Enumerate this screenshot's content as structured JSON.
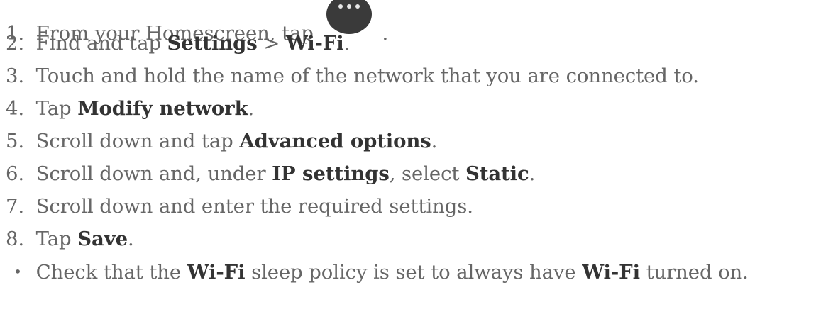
{
  "steps": [
    {
      "num": "1.",
      "parts": [
        "From your Homescreen, tap",
        "."
      ]
    },
    {
      "num": "2.",
      "parts": [
        "Find and tap ",
        "Settings",
        " > ",
        "Wi-Fi",
        "."
      ]
    },
    {
      "num": "3.",
      "parts": [
        "Touch and hold the name of the network that you are connected to."
      ]
    },
    {
      "num": "4.",
      "parts": [
        "Tap ",
        "Modify network",
        "."
      ]
    },
    {
      "num": "5.",
      "parts": [
        "Scroll down and tap ",
        "Advanced options",
        "."
      ]
    },
    {
      "num": "6.",
      "parts": [
        "Scroll down and, under ",
        "IP settings",
        ", select ",
        "Static",
        "."
      ]
    },
    {
      "num": "7.",
      "parts": [
        "Scroll down and enter the required settings."
      ]
    },
    {
      "num": "8.",
      "parts": [
        "Tap ",
        "Save",
        "."
      ]
    }
  ],
  "note": {
    "bullet": "•",
    "parts": [
      "Check that the ",
      "Wi-Fi",
      " sleep policy is set to always have ",
      "Wi-Fi",
      " turned on."
    ]
  },
  "icons": {
    "apps": "apps-icon"
  },
  "colors": {
    "text": "#666666",
    "bold": "#333333",
    "icon": "#3a3a3a"
  }
}
